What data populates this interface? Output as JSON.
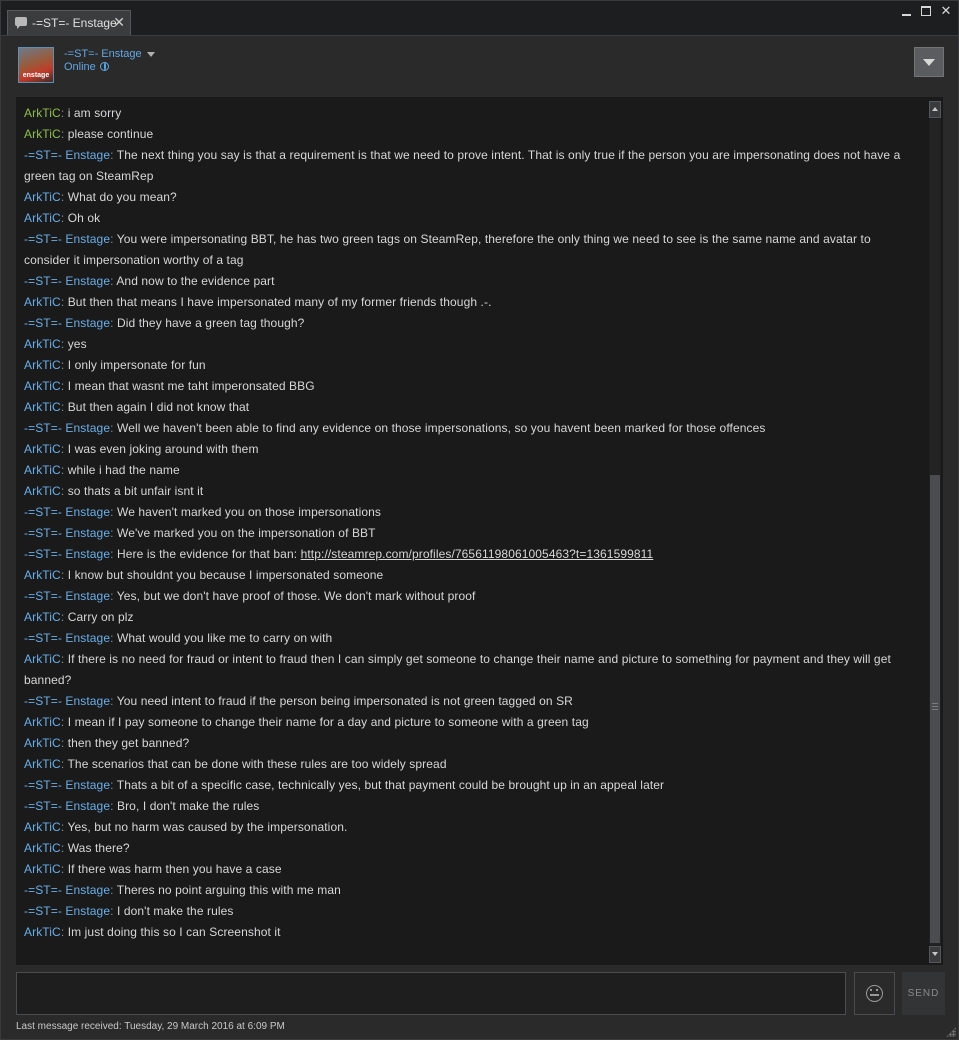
{
  "tab": {
    "title": "-=ST=- Enstage",
    "close_glyph": "✕"
  },
  "window_controls": {
    "close_glyph": "✕"
  },
  "header": {
    "avatar_text": "enstage",
    "friend_name": "-=ST=- Enstage",
    "status": "Online"
  },
  "messages": [
    {
      "speaker": "ArkTiC",
      "text": "i am sorry",
      "in_game": true
    },
    {
      "speaker": "ArkTiC",
      "text": "please continue",
      "in_game": true
    },
    {
      "speaker": "-=ST=- Enstage",
      "text": "The next thing you say is that a requirement is that we need to prove intent. That is only true if the person you are impersonating does not have a green tag on SteamRep"
    },
    {
      "speaker": "ArkTiC",
      "text": "What do you mean?"
    },
    {
      "speaker": "ArkTiC",
      "text": "Oh ok"
    },
    {
      "speaker": "-=ST=- Enstage",
      "text": "You were impersonating BBT, he has two green tags on SteamRep, therefore the only thing we need to see is the same name and avatar to consider it impersonation worthy of a tag"
    },
    {
      "speaker": "-=ST=- Enstage",
      "text": "And now to the evidence part"
    },
    {
      "speaker": "ArkTiC",
      "text": "But then that means I have impersonated many of my former friends though .-."
    },
    {
      "speaker": "-=ST=- Enstage",
      "text": "Did they have a green tag though?"
    },
    {
      "speaker": "ArkTiC",
      "text": "yes"
    },
    {
      "speaker": "ArkTiC",
      "text": "I only impersonate for fun"
    },
    {
      "speaker": "ArkTiC",
      "text": "I mean that wasnt me taht imperonsated BBG"
    },
    {
      "speaker": "ArkTiC",
      "text": "But then again I did not know that"
    },
    {
      "speaker": "-=ST=- Enstage",
      "text": "Well we haven't been able to find any evidence on those impersonations, so you havent been marked for those offences"
    },
    {
      "speaker": "ArkTiC",
      "text": "I was even joking around with them"
    },
    {
      "speaker": "ArkTiC",
      "text": "while i had the name"
    },
    {
      "speaker": "ArkTiC",
      "text": "so thats a bit unfair isnt it"
    },
    {
      "speaker": "-=ST=- Enstage",
      "text": "We haven't marked you on those impersonations"
    },
    {
      "speaker": "-=ST=- Enstage",
      "text": "We've marked you on the impersonation of BBT"
    },
    {
      "speaker": "-=ST=- Enstage",
      "text": "Here is the evidence for that ban: ",
      "link": "http://steamrep.com/profiles/76561198061005463?t=1361599811"
    },
    {
      "speaker": "ArkTiC",
      "text": "I know but shouldnt you because I impersonated someone"
    },
    {
      "speaker": "-=ST=- Enstage",
      "text": "Yes, but we don't have proof of those. We don't mark without proof"
    },
    {
      "speaker": "ArkTiC",
      "text": "Carry on plz"
    },
    {
      "speaker": "-=ST=- Enstage",
      "text": "What would you like me to carry on with"
    },
    {
      "speaker": "ArkTiC",
      "text": "If there is no need for fraud or intent to fraud then I can simply get someone to change their name and picture to something for payment and they will get banned?"
    },
    {
      "speaker": "-=ST=- Enstage",
      "text": "You need intent to fraud if the person being impersonated is not green tagged on SR"
    },
    {
      "speaker": "ArkTiC",
      "text": "I mean if I pay someone to change their name for a day and picture to someone with a green tag"
    },
    {
      "speaker": "ArkTiC",
      "text": "then they get banned?"
    },
    {
      "speaker": "ArkTiC",
      "text": "The scenarios that can be done with these rules are too widely spread"
    },
    {
      "speaker": "-=ST=- Enstage",
      "text": "Thats a bit of a specific case, technically yes, but that payment could be brought up in an appeal later"
    },
    {
      "speaker": "-=ST=- Enstage",
      "text": "Bro, I don't make the rules"
    },
    {
      "speaker": "ArkTiC",
      "text": "Yes, but no harm was caused by the impersonation."
    },
    {
      "speaker": "ArkTiC",
      "text": "Was there?"
    },
    {
      "speaker": "ArkTiC",
      "text": "If there was harm then you have a case"
    },
    {
      "speaker": "-=ST=- Enstage",
      "text": "Theres no point arguing this with me man"
    },
    {
      "speaker": "-=ST=- Enstage",
      "text": "I don't make the rules"
    },
    {
      "speaker": "ArkTiC",
      "text": "Im just doing this so I can Screenshot it"
    }
  ],
  "input": {
    "value": "",
    "placeholder": ""
  },
  "send_label": "SEND",
  "footer": {
    "status": "Last message received: Tuesday, 29 March 2016 at 6:09 PM"
  },
  "colors": {
    "speaker_blue": "#6aaee8",
    "speaker_ingame_green": "#8ebe4a",
    "message_text": "#d7d7d7",
    "background": "#2a2a2b",
    "log_background": "#1a1a1b"
  }
}
